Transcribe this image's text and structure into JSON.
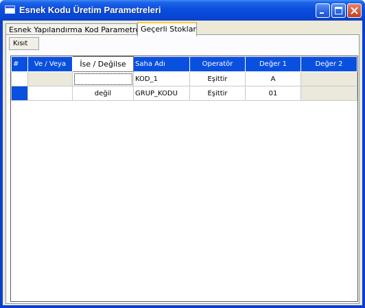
{
  "window": {
    "title": "Esnek Kodu Üretim Parametreleri"
  },
  "tabs": [
    {
      "label": "Esnek Yapılandırma Kod Parametreleri"
    },
    {
      "label": "Geçerli Stoklar"
    }
  ],
  "toolbar": {
    "kisit_label": "Kısıt"
  },
  "grid": {
    "columns": [
      "#",
      "Ve / Veya",
      "İse / Değilse",
      "Saha Adı",
      "Operatör",
      "Değer 1",
      "Değer 2"
    ],
    "rows": [
      {
        "ve_veya": "",
        "ise_degilse": "",
        "saha_adi": "KOD_1",
        "operator": "Eşittir",
        "deger1": "A",
        "deger2": ""
      },
      {
        "ve_veya": "",
        "ise_degilse": "değil",
        "saha_adi": "GRUP_KODU",
        "operator": "Eşittir",
        "deger1": "01",
        "deger2": ""
      }
    ]
  }
}
